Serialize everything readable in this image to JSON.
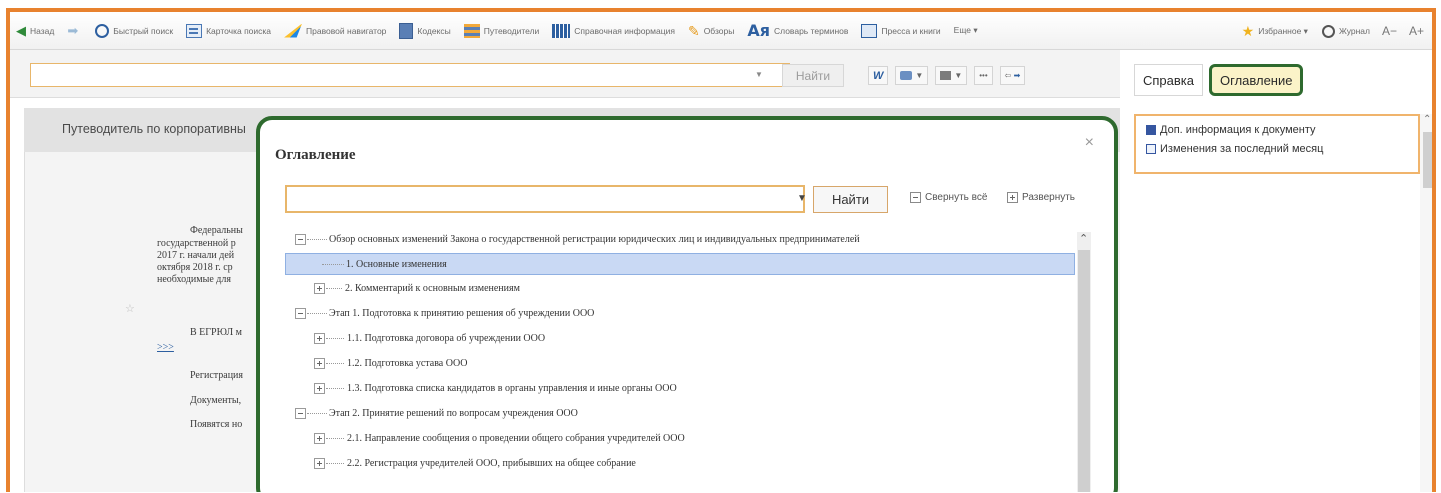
{
  "toolbar": {
    "back": "Назад",
    "quick_search": "Быстрый поиск",
    "search_card": "Карточка поиска",
    "legal_navigator": "Правовой навигатор",
    "codes": "Кодексы",
    "guides": "Путеводители",
    "reference": "Справочная информация",
    "reviews": "Обзоры",
    "dict_mark": "Ая",
    "dictionary": "Словарь терминов",
    "press": "Пресса и книги",
    "more": "Еще ▾",
    "favorites": "Избранное ▾",
    "journal": "Журнал",
    "font_decrease": "A−",
    "font_increase": "A+"
  },
  "search": {
    "value": "",
    "find_label": "Найти"
  },
  "doc": {
    "header": "Путеводитель по корпоративны",
    "lines": [
      "Федеральны",
      "государственной р",
      "2017 г. начали дей",
      "октября 2018 г. ср",
      "необходимые для"
    ],
    "egrul": "В ЕГРЮЛ м",
    "link": ">>>",
    "reg": "Регистрация",
    "docs": "Документы,",
    "appear": "Появятся но"
  },
  "right_panel": {
    "tab_help": "Справка",
    "tab_toc": "Оглавление",
    "extra_info": "Доп. информация к документу",
    "changes": "Изменения за последний месяц"
  },
  "modal": {
    "title": "Оглавление",
    "search_value": "",
    "find_label": "Найти",
    "collapse_all": "Свернуть всё",
    "expand": "Развернуть",
    "items": [
      {
        "label": "Обзор основных изменений Закона о государственной регистрации юридических лиц и индивидуальных предпринимателей",
        "state": "expanded"
      },
      {
        "label": "1. Основные изменения",
        "state": "leaf",
        "selected": true
      },
      {
        "label": "2. Комментарий к основным изменениям",
        "state": "collapsed"
      },
      {
        "label": "Этап 1. Подготовка к принятию решения об учреждении ООО",
        "state": "expanded"
      },
      {
        "label": "1.1. Подготовка договора об учреждении ООО",
        "state": "collapsed"
      },
      {
        "label": "1.2. Подготовка устава ООО",
        "state": "collapsed"
      },
      {
        "label": "1.3. Подготовка списка кандидатов в органы управления и иные органы ООО",
        "state": "collapsed"
      },
      {
        "label": "Этап 2. Принятие решений по вопросам учреждения ООО",
        "state": "expanded"
      },
      {
        "label": "2.1. Направление сообщения о проведении общего собрания учредителей ООО",
        "state": "collapsed"
      },
      {
        "label": "2.2. Регистрация учредителей ООО, прибывших на общее собрание",
        "state": "collapsed"
      }
    ]
  },
  "colors": {
    "highlight_border": "#2e6a2e",
    "frame_border": "#e8822e",
    "selected_row": "#c9d9f4"
  }
}
